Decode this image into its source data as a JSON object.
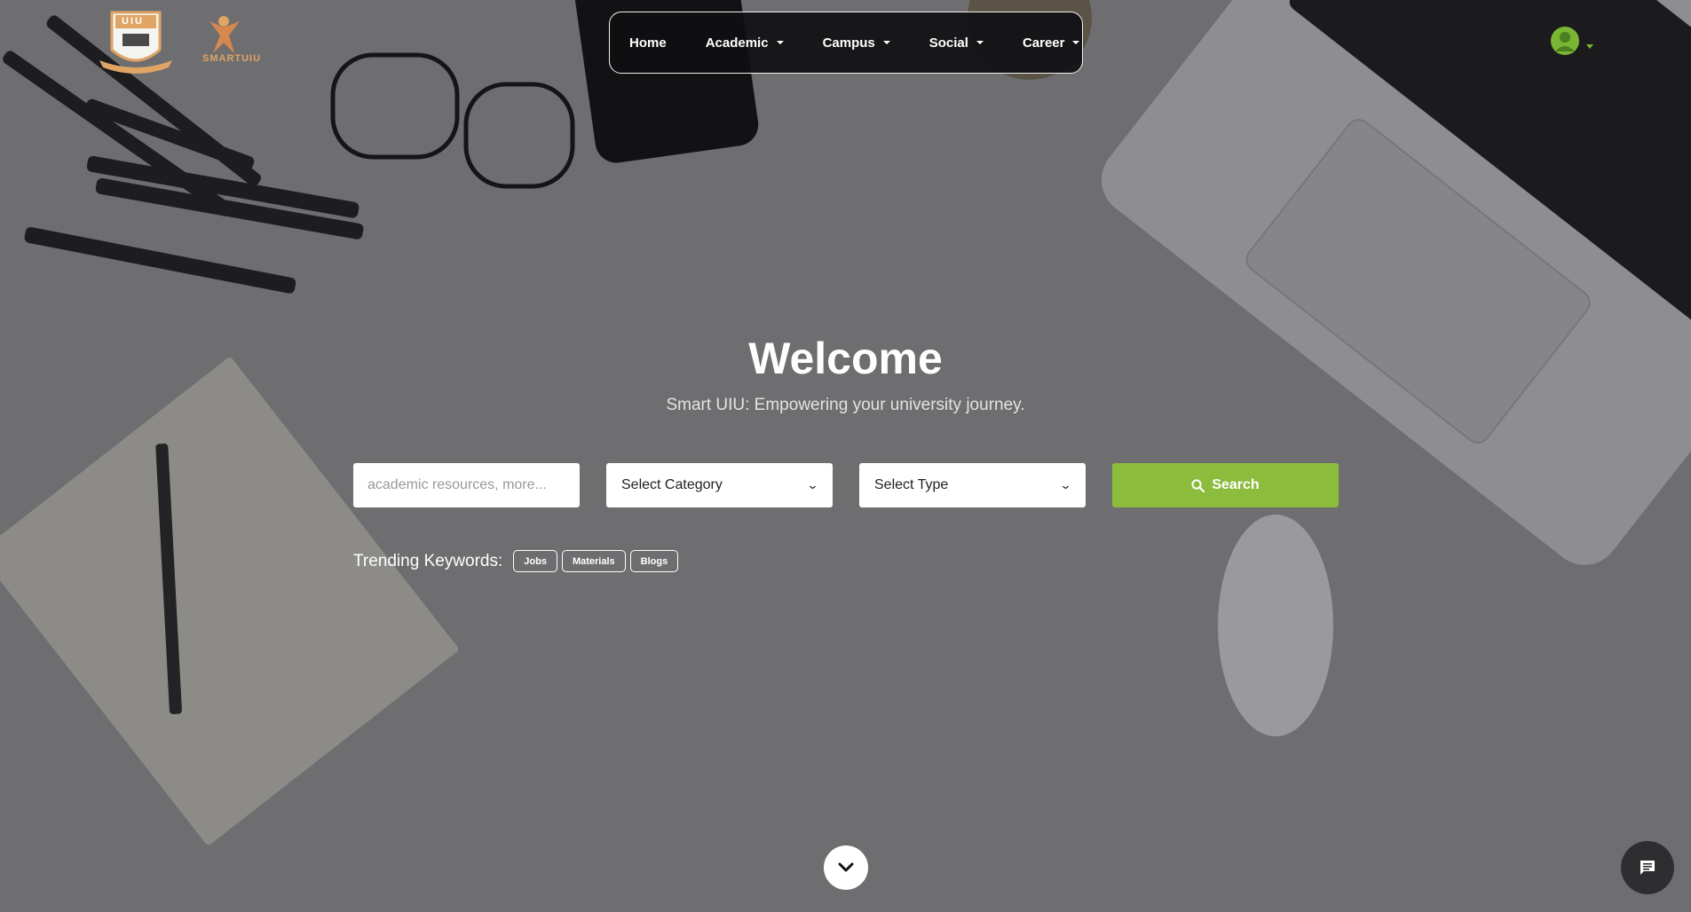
{
  "logos": {
    "uiu_label": "UIU",
    "smart_label": "SMARTUIU"
  },
  "nav": {
    "items": [
      {
        "label": "Home",
        "dropdown": false
      },
      {
        "label": "Academic",
        "dropdown": true
      },
      {
        "label": "Campus",
        "dropdown": true
      },
      {
        "label": "Social",
        "dropdown": true
      },
      {
        "label": "Career",
        "dropdown": true
      }
    ]
  },
  "hero": {
    "title": "Welcome",
    "subtitle": "Smart UIU: Empowering your university journey."
  },
  "search": {
    "placeholder": "academic resources, more...",
    "category_label": "Select Category",
    "type_label": "Select Type",
    "button_label": "Search"
  },
  "trending": {
    "label": "Trending Keywords:",
    "keywords": [
      "Jobs",
      "Materials",
      "Blogs"
    ]
  },
  "colors": {
    "accent": "#8bbc3c",
    "avatar": "#7ab534",
    "navbar_bg": "#0f0f12",
    "logo_orange": "#e0a464"
  },
  "icons": {
    "search": "search-icon",
    "chevron": "chevron-down-icon",
    "chat": "chat-icon",
    "user": "user-icon"
  }
}
